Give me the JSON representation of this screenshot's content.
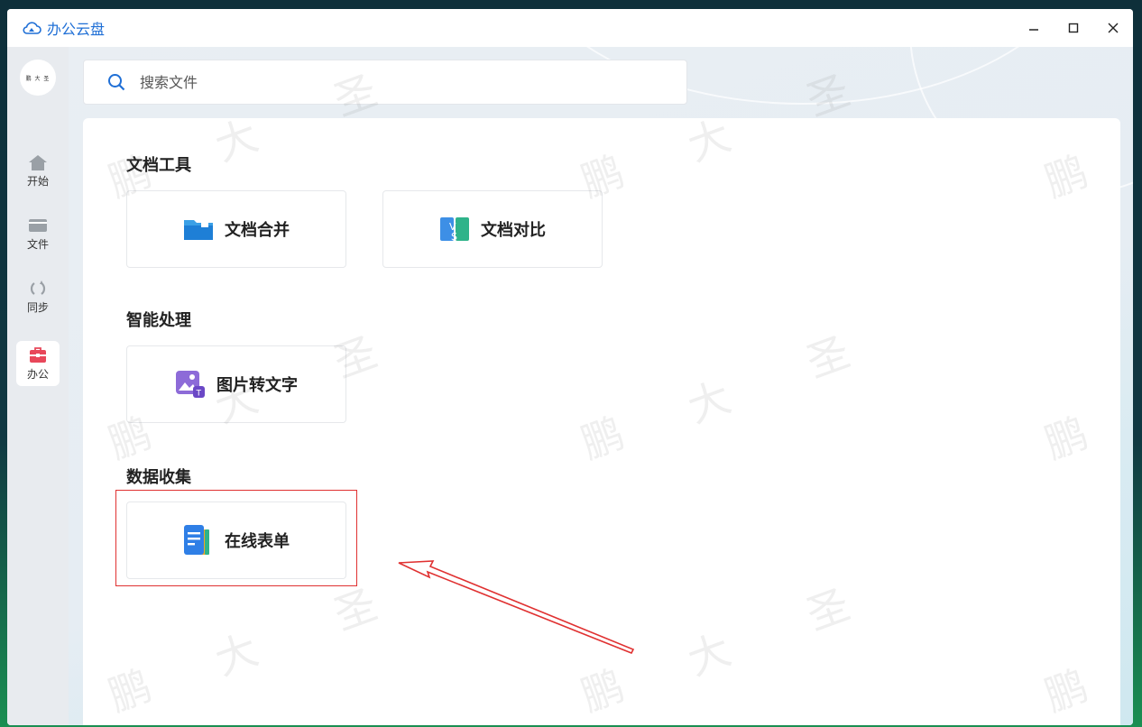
{
  "window": {
    "title": "办公云盘",
    "controls": [
      "–",
      "□",
      "×"
    ]
  },
  "sidebar": {
    "avatar_text": "鹏 大 圣",
    "items": [
      {
        "label": "开始",
        "icon": "home-icon"
      },
      {
        "label": "文件",
        "icon": "folder-icon"
      },
      {
        "label": "同步",
        "icon": "sync-icon"
      },
      {
        "label": "办公",
        "icon": "toolbox-icon"
      }
    ]
  },
  "search": {
    "placeholder": "搜索文件"
  },
  "sections": {
    "doc_tools": {
      "title": "文档工具",
      "cards": [
        {
          "label": "文档合并",
          "icon": "merge-folder-icon"
        },
        {
          "label": "文档对比",
          "icon": "compare-vs-icon"
        }
      ]
    },
    "smart": {
      "title": "智能处理",
      "cards": [
        {
          "label": "图片转文字",
          "icon": "image-to-text-icon"
        }
      ]
    },
    "data_collect": {
      "title": "数据收集",
      "cards": [
        {
          "label": "在线表单",
          "icon": "online-form-icon"
        }
      ]
    }
  },
  "watermark": [
    "鹏",
    "大",
    "圣"
  ],
  "colors": {
    "accent": "#1f6fd6",
    "highlight": "#e03131"
  }
}
